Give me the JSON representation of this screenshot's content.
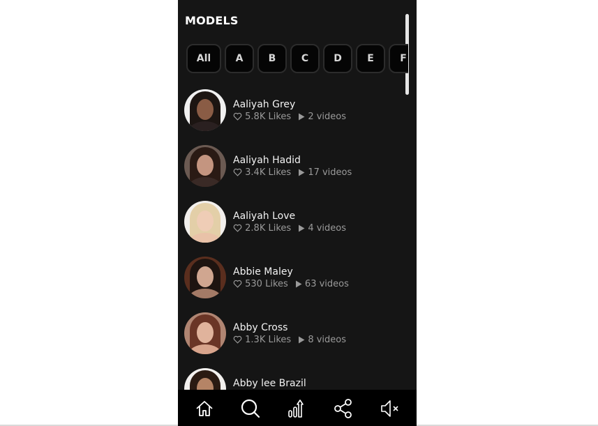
{
  "header": {
    "title": "MODELS"
  },
  "letter_filters": [
    "All",
    "A",
    "B",
    "C",
    "D",
    "E",
    "F"
  ],
  "models": [
    {
      "name": "Aaliyah Grey",
      "likes": "5.8K Likes",
      "videos": "2 videos",
      "avatar": {
        "bg": "#f0f0f0",
        "hair": "#1c1512",
        "face": "#8a5c45",
        "body": "#2a2020"
      }
    },
    {
      "name": "Aaliyah Hadid",
      "likes": "3.4K Likes",
      "videos": "17 videos",
      "avatar": {
        "bg": "#6b5a52",
        "hair": "#2a1a14",
        "face": "#c49580",
        "body": "#3a2a26"
      }
    },
    {
      "name": "Aaliyah Love",
      "likes": "2.8K Likes",
      "videos": "4 videos",
      "avatar": {
        "bg": "#f2efec",
        "hair": "#e3cfa8",
        "face": "#efcdb6",
        "body": "#e9c2a8"
      }
    },
    {
      "name": "Abbie Maley",
      "likes": "530 Likes",
      "videos": "63 videos",
      "avatar": {
        "bg": "#5a2e1e",
        "hair": "#1e1410",
        "face": "#d0a690",
        "body": "#a37a66"
      }
    },
    {
      "name": "Abby Cross",
      "likes": "1.3K Likes",
      "videos": "8 videos",
      "avatar": {
        "bg": "#b08572",
        "hair": "#6a3526",
        "face": "#e0b39c",
        "body": "#d8a48c"
      }
    },
    {
      "name": "Abby lee Brazil",
      "likes": "",
      "videos": "",
      "avatar": {
        "bg": "#f2f0ee",
        "hair": "#2a1a12",
        "face": "#b58466",
        "body": "#2a1a12"
      }
    }
  ],
  "bottom_nav": [
    {
      "label": "home",
      "icon": "home-icon"
    },
    {
      "label": "search",
      "icon": "search-icon"
    },
    {
      "label": "trending",
      "icon": "trending-icon"
    },
    {
      "label": "share",
      "icon": "share-icon"
    },
    {
      "label": "mute",
      "icon": "mute-icon"
    }
  ],
  "colors": {
    "panel_bg": "#151515",
    "nav_bg": "#000000",
    "text_primary": "#f2f2f2",
    "text_secondary": "#9a9a9a"
  }
}
